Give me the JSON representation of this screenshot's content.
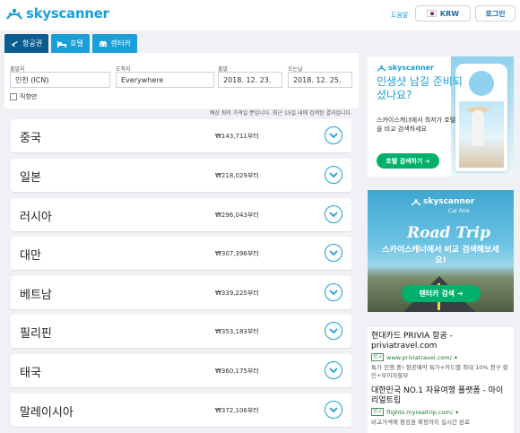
{
  "header": {
    "logo_text": "skyscanner",
    "help_label": "도움말",
    "currency_label": "KRW",
    "login_label": "로그인"
  },
  "tabs": [
    {
      "label": "항공권",
      "icon": "plane-icon",
      "active": true
    },
    {
      "label": "호텔",
      "icon": "bed-icon",
      "active": false
    },
    {
      "label": "렌터카",
      "icon": "car-icon",
      "active": false
    }
  ],
  "search": {
    "origin_label": "출발지",
    "origin_value": "인천 (ICN)",
    "destination_label": "도착지",
    "destination_value": "Everywhere",
    "depart_label": "출발",
    "depart_value": "2018. 12. 23.",
    "return_label": "오는날",
    "return_value": "2018. 12. 25.",
    "direct_label": "직항만"
  },
  "disclaimer": "예상 최저 가격일 뿐입니다. 최근 15일 내에 검색된 결과입니다.",
  "results": [
    {
      "country": "중국",
      "price": "₩143,711부터"
    },
    {
      "country": "일본",
      "price": "₩218,029부터"
    },
    {
      "country": "러시아",
      "price": "₩296,043부터"
    },
    {
      "country": "대만",
      "price": "₩307,396부터"
    },
    {
      "country": "베트남",
      "price": "₩339,225부터"
    },
    {
      "country": "필리핀",
      "price": "₩353,183부터"
    },
    {
      "country": "태국",
      "price": "₩360,175부터"
    },
    {
      "country": "말레이시아",
      "price": "₩372,106부터"
    }
  ],
  "hotel_ad": {
    "logo_text": "skyscanner",
    "title": "인생샷 남길 준비되셨나요?",
    "body": "스카이스캐너에서 최저가 호텔을 비교 검색하세요",
    "button_label": "호텔 검색하기 ➔"
  },
  "car_ad": {
    "logo_text": "skyscanner",
    "sub_text": "Car hire",
    "script_text": "Road Trip",
    "body": "스카이스캐너에서 비교 검색해보세요!",
    "button_label": "렌터카 검색 ➔"
  },
  "text_ads": [
    {
      "title": "현대카드 PRIVIA 항공 - priviatravel.com",
      "badge": "광고",
      "url": "www.priviatravel.com/",
      "desc": "특가 진행 중! 항공예약 특가+카드별 최대 10% 청구 할인+무이자할부"
    },
    {
      "title": "대한민국 NO.1 자유여행 플랫폼 - 마이리얼트립",
      "badge": "광고",
      "url": "flights.myrealtrip.com/",
      "desc": "비교가격에 항공권 확정까지 실시간 완료"
    }
  ],
  "colors": {
    "brand": "#1b9fd8",
    "active_tab": "#0b5d8f",
    "cta": "#00b06b"
  }
}
